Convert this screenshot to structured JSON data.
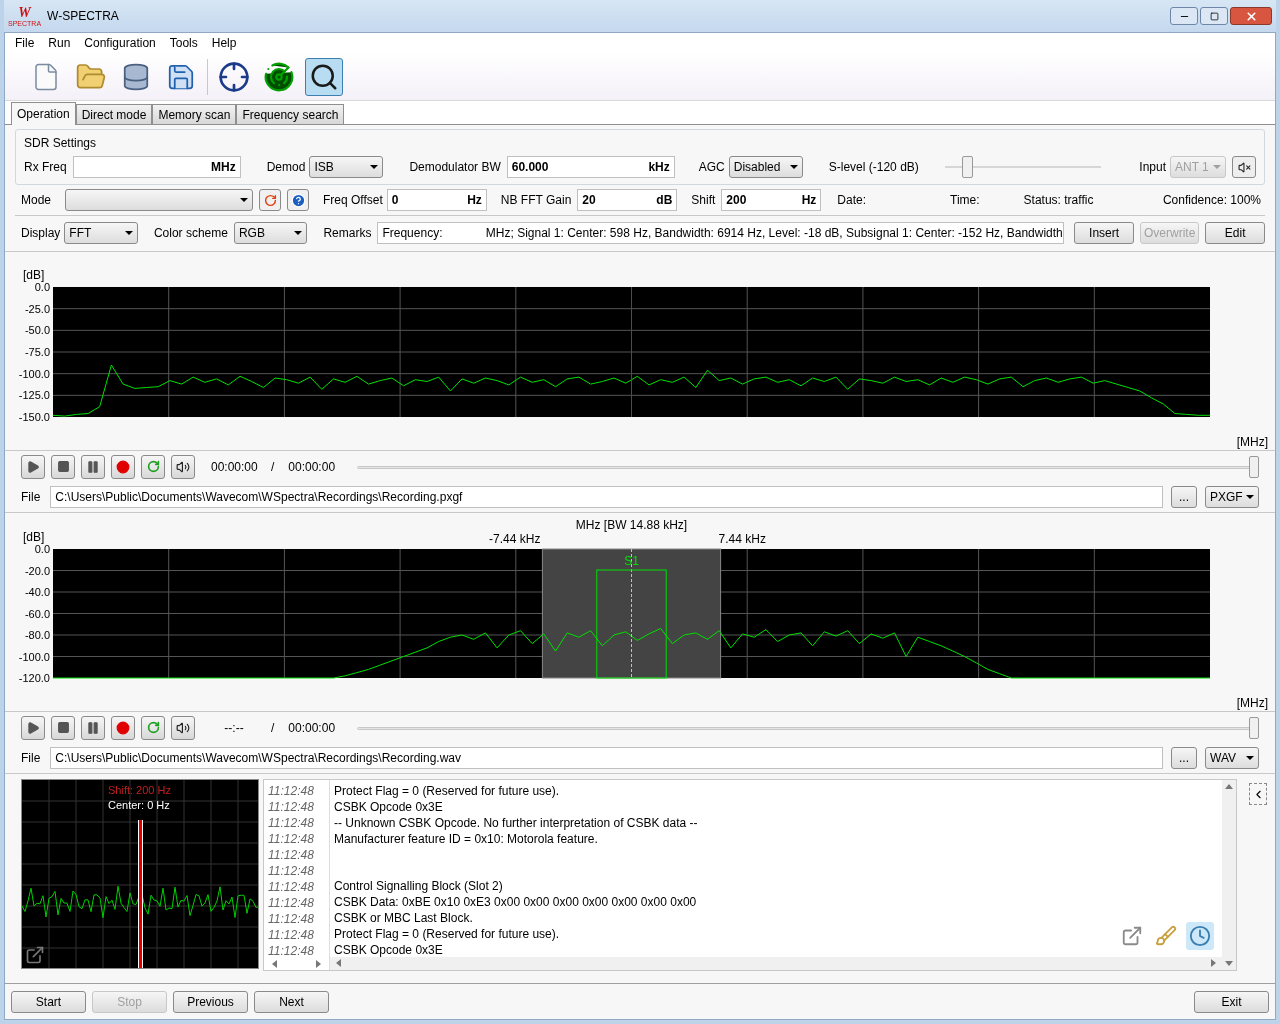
{
  "window": {
    "title": "W-SPECTRA",
    "logo": {
      "letter": "W",
      "caption": "SPECTRA"
    }
  },
  "menu": [
    "File",
    "Run",
    "Configuration",
    "Tools",
    "Help"
  ],
  "toolbar": [
    {
      "kind": "new",
      "selected": false
    },
    {
      "kind": "open",
      "selected": false
    },
    {
      "kind": "database",
      "selected": false
    },
    {
      "kind": "save",
      "selected": false
    },
    {
      "kind": "target",
      "selected": false
    },
    {
      "kind": "radar",
      "selected": false
    },
    {
      "kind": "search",
      "selected": true
    }
  ],
  "tabs": [
    {
      "label": "Operation",
      "selected": true
    },
    {
      "label": "Direct mode",
      "selected": false
    },
    {
      "label": "Memory scan",
      "selected": false
    },
    {
      "label": "Frequency search",
      "selected": false
    }
  ],
  "sdr_settings": {
    "title": "SDR Settings",
    "rx_freq": {
      "label": "Rx Freq",
      "unit": "MHz"
    },
    "demod": {
      "label": "Demod",
      "value": "ISB"
    },
    "demodulator_bw": {
      "label": "Demodulator BW",
      "value": "60.000",
      "unit": "kHz"
    },
    "agc": {
      "label": "AGC",
      "value": "Disabled"
    },
    "s_level": {
      "label": "S-level  (-120 dB)",
      "level": 0.12
    },
    "input": {
      "label": "Input",
      "value": "ANT 1",
      "disabled": true
    }
  },
  "mode_row": {
    "mode_label": "Mode",
    "freq_offset": {
      "label": "Freq Offset",
      "value": "0",
      "unit": "Hz"
    },
    "nb_fft_gain": {
      "label": "NB FFT Gain",
      "value": "20",
      "unit": "dB"
    },
    "shift": {
      "label": "Shift",
      "value": "200",
      "unit": "Hz"
    },
    "date": "Date:",
    "time": "Time:",
    "status": "Status: traffic",
    "confidence": "Confidence: 100%"
  },
  "display_row": {
    "display": {
      "label": "Display",
      "value": "FFT"
    },
    "color_scheme": {
      "label": "Color scheme",
      "value": "RGB"
    },
    "remarks": {
      "label": "Remarks",
      "value": "Frequency:             MHz; Signal 1: Center: 598 Hz, Bandwidth: 6914 Hz, Level: -18 dB, Subsignal 1: Center: -152 Hz, Bandwidth:"
    },
    "buttons": [
      {
        "label": "Insert",
        "disabled": false
      },
      {
        "label": "Overwrite",
        "disabled": true
      },
      {
        "label": "Edit",
        "disabled": false
      }
    ]
  },
  "wide_spectrum": {
    "chart_data": {
      "type": "line",
      "ylabel": "[dB]",
      "xlabel": "[MHz]",
      "ylim": [
        -150,
        0
      ],
      "yticks": [
        {
          "value": 0,
          "label": "0.0"
        },
        {
          "value": -25,
          "label": "-25.0"
        },
        {
          "value": -50,
          "label": "-50.0"
        },
        {
          "value": -75,
          "label": "-75.0"
        },
        {
          "value": -100,
          "label": "-100.0"
        },
        {
          "value": -125,
          "label": "-125.0"
        },
        {
          "value": -150,
          "label": "-150.0"
        }
      ],
      "grid": true,
      "series": [
        {
          "color": "#00e000",
          "values": [
            -148,
            -149,
            -147,
            -146,
            -138,
            -90,
            -112,
            -117,
            -116,
            -115,
            -108,
            -112,
            -104,
            -110,
            -106,
            -113,
            -103,
            -109,
            -116,
            -105,
            -107,
            -111,
            -104,
            -118,
            -106,
            -110,
            -103,
            -112,
            -108,
            -105,
            -114,
            -107,
            -109,
            -104,
            -120,
            -106,
            -111,
            -105,
            -108,
            -113,
            -104,
            -110,
            -107,
            -115,
            -106,
            -104,
            -112,
            -109,
            -105,
            -111,
            -103,
            -113,
            -107,
            -110,
            -104,
            -116,
            -96,
            -108,
            -105,
            -112,
            -106,
            -104,
            -110,
            -107,
            -114,
            -105,
            -109,
            -104,
            -118,
            -106,
            -108,
            -111,
            -104,
            -109,
            -107,
            -113,
            -105,
            -110,
            -104,
            -107,
            -112,
            -106,
            -104,
            -115,
            -108,
            -105,
            -110,
            -106,
            -104,
            -111,
            -108,
            -112,
            -116,
            -120,
            -128,
            -135,
            -146,
            -147,
            -148,
            -148
          ]
        }
      ]
    }
  },
  "player_1": {
    "position": "00:00:00",
    "separator": "/",
    "duration": "00:00:00",
    "level": 1,
    "file_label": "File",
    "path": "C:\\Users\\Public\\Documents\\Wavecom\\WSpectra\\Recordings\\Recording.pxgf",
    "browse": "...",
    "format": "PXGF"
  },
  "narrow_spectrum": {
    "chart_data": {
      "type": "line",
      "title": "MHz [BW 14.88 kHz]",
      "ylabel": "[dB]",
      "xlabel": "[MHz]",
      "ylim": [
        -120,
        0
      ],
      "yticks": [
        {
          "value": 0,
          "label": "0.0"
        },
        {
          "value": -20,
          "label": "-20.0"
        },
        {
          "value": -40,
          "label": "-40.0"
        },
        {
          "value": -60,
          "label": "-60.0"
        },
        {
          "value": -80,
          "label": "-80.0"
        },
        {
          "value": -100,
          "label": "-100.0"
        },
        {
          "value": -120,
          "label": "-120.0"
        }
      ],
      "grid": true,
      "series": [
        {
          "color": "#00e000",
          "values": [
            -120,
            -120,
            -120,
            -120,
            -120,
            -120,
            -120,
            -120,
            -120,
            -120,
            -120,
            -120,
            -120,
            -120,
            -120,
            -120,
            -120,
            -120,
            -120,
            -120,
            -120,
            -120,
            -120,
            -120,
            -120,
            -118,
            -115,
            -112,
            -108,
            -104,
            -100,
            -96,
            -92,
            -86,
            -82,
            -80,
            -84,
            -78,
            -92,
            -80,
            -76,
            -88,
            -79,
            -95,
            -78,
            -82,
            -76,
            -90,
            -80,
            -77,
            -85,
            -79,
            -74,
            -88,
            -80,
            -78,
            -84,
            -76,
            -92,
            -79,
            -82,
            -75,
            -86,
            -80,
            -78,
            -90,
            -77,
            -81,
            -76,
            -88,
            -79,
            -83,
            -78,
            -100,
            -82,
            -86,
            -90,
            -95,
            -100,
            -106,
            -112,
            -116,
            -120,
            -120,
            -120,
            -120,
            -120,
            -120,
            -120,
            -120,
            -120,
            -120,
            -120,
            -120,
            -120,
            -120,
            -120,
            -120,
            -120,
            -120
          ]
        }
      ]
    },
    "bandwidth": {
      "label_left": "-7.44 kHz",
      "label_right": "7.44 kHz"
    },
    "signal": {
      "label": "S1"
    }
  },
  "player_2": {
    "position": "--:--",
    "separator": "/",
    "duration": "00:00:00",
    "level": 1,
    "file_label": "File",
    "path": "C:\\Users\\Public\\Documents\\Wavecom\\WSpectra\\Recordings\\Recording.wav",
    "browse": "...",
    "format": "WAV"
  },
  "scope": {
    "shift": "Shift: 200 Hz",
    "center": "Center: 0 Hz"
  },
  "log": [
    {
      "time": "11:12:48",
      "message": "Protect Flag = 0 (Reserved for future use)."
    },
    {
      "time": "11:12:48",
      "message": "CSBK Opcode 0x3E"
    },
    {
      "time": "11:12:48",
      "message": "-- Unknown CSBK Opcode. No further interpretation of CSBK data --"
    },
    {
      "time": "11:12:48",
      "message": "Manufacturer feature ID = 0x10: Motorola feature."
    },
    {
      "time": "11:12:48"
    },
    {
      "time": "11:12:48"
    },
    {
      "time": "11:12:48",
      "message": "Control Signalling Block (Slot 2)"
    },
    {
      "time": "11:12:48",
      "message": "CSBK Data: 0xBE 0x10 0xE3 0x00 0x00 0x00 0x00 0x00 0x00 0x00"
    },
    {
      "time": "11:12:48",
      "message": "CSBK or MBC Last Block."
    },
    {
      "time": "11:12:48",
      "message": "Protect Flag = 0 (Reserved for future use)."
    },
    {
      "time": "11:12:48",
      "message": "CSBK Opcode 0x3E"
    }
  ],
  "log_tools": [
    {
      "kind": "popout",
      "selected": false
    },
    {
      "kind": "clear",
      "selected": false
    },
    {
      "kind": "clock",
      "selected": true
    }
  ],
  "footer": [
    {
      "label": "Start",
      "disabled": false
    },
    {
      "label": "Stop",
      "disabled": true
    },
    {
      "label": "Previous",
      "disabled": false
    },
    {
      "label": "Next",
      "disabled": false
    },
    {
      "label": "Exit",
      "disabled": false
    }
  ]
}
